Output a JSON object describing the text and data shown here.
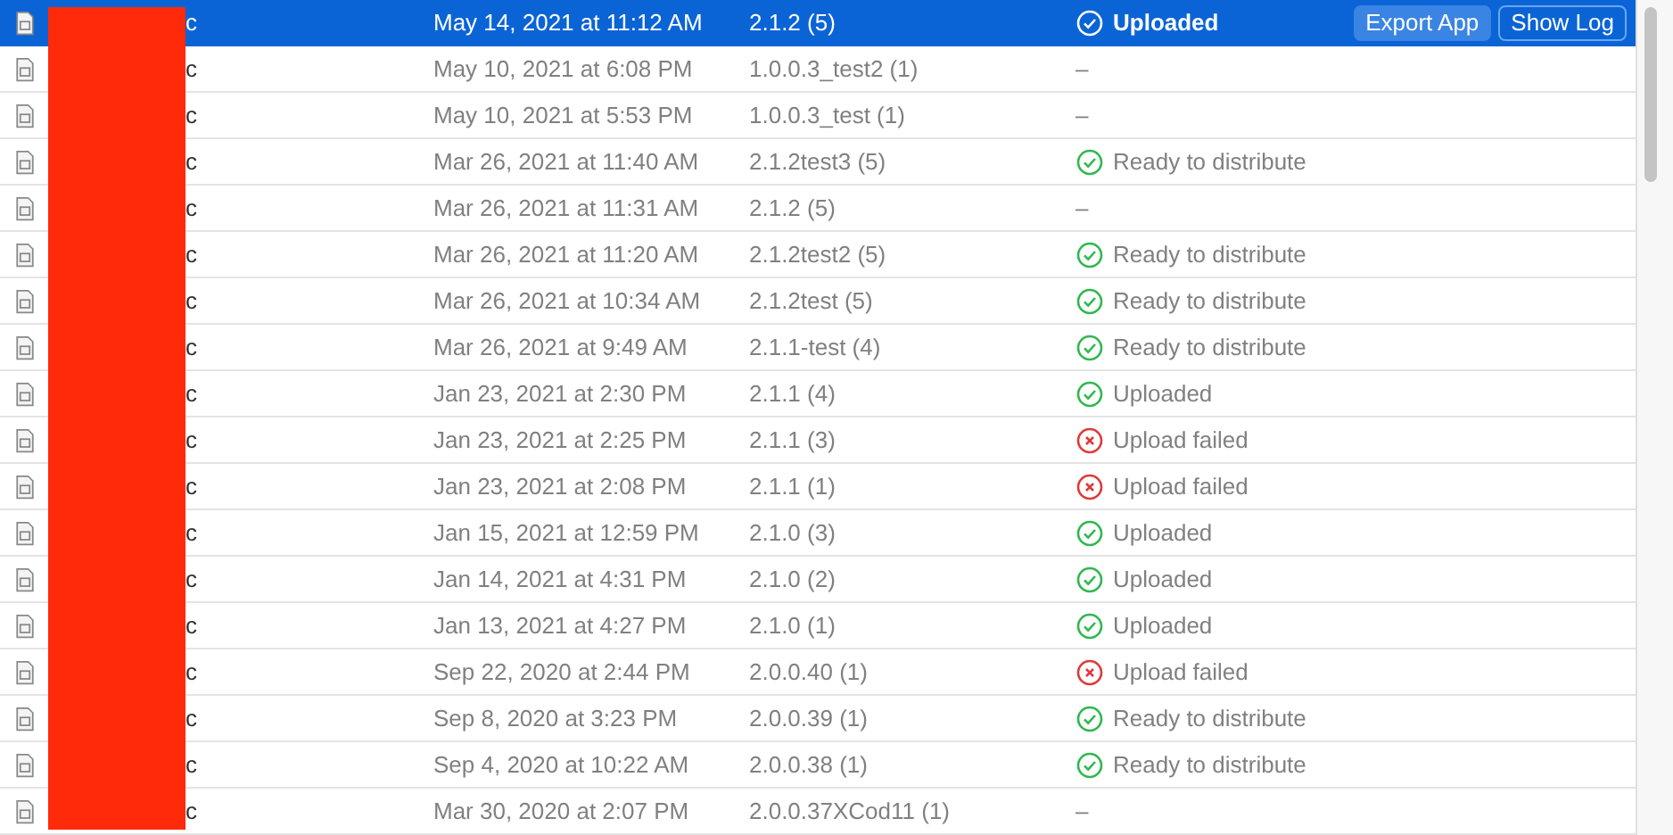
{
  "archives": [
    {
      "name": "c",
      "date": "May 14, 2021 at 11:12 AM",
      "version": "2.1.2 (5)",
      "status": {
        "kind": "success",
        "label": "Uploaded"
      },
      "selected": true,
      "actions": [
        "Export App",
        "Show Log"
      ]
    },
    {
      "name": "c",
      "date": "May 10, 2021 at 6:08 PM",
      "version": "1.0.0.3_test2 (1)",
      "status": {
        "kind": "none",
        "label": "–"
      },
      "selected": false
    },
    {
      "name": "c",
      "date": "May 10, 2021 at 5:53 PM",
      "version": "1.0.0.3_test (1)",
      "status": {
        "kind": "none",
        "label": "–"
      },
      "selected": false
    },
    {
      "name": "c",
      "date": "Mar 26, 2021 at 11:40 AM",
      "version": "2.1.2test3 (5)",
      "status": {
        "kind": "success",
        "label": "Ready to distribute"
      },
      "selected": false
    },
    {
      "name": "c",
      "date": "Mar 26, 2021 at 11:31 AM",
      "version": "2.1.2 (5)",
      "status": {
        "kind": "none",
        "label": "–"
      },
      "selected": false
    },
    {
      "name": "c",
      "date": "Mar 26, 2021 at 11:20 AM",
      "version": "2.1.2test2 (5)",
      "status": {
        "kind": "success",
        "label": "Ready to distribute"
      },
      "selected": false
    },
    {
      "name": "c",
      "date": "Mar 26, 2021 at 10:34 AM",
      "version": "2.1.2test (5)",
      "status": {
        "kind": "success",
        "label": "Ready to distribute"
      },
      "selected": false
    },
    {
      "name": "c",
      "date": "Mar 26, 2021 at 9:49 AM",
      "version": "2.1.1-test (4)",
      "status": {
        "kind": "success",
        "label": "Ready to distribute"
      },
      "selected": false
    },
    {
      "name": "c",
      "date": "Jan 23, 2021 at 2:30 PM",
      "version": "2.1.1 (4)",
      "status": {
        "kind": "success",
        "label": "Uploaded"
      },
      "selected": false
    },
    {
      "name": "c",
      "date": "Jan 23, 2021 at 2:25 PM",
      "version": "2.1.1 (3)",
      "status": {
        "kind": "failed",
        "label": "Upload failed"
      },
      "selected": false
    },
    {
      "name": "c",
      "date": "Jan 23, 2021 at 2:08 PM",
      "version": "2.1.1 (1)",
      "status": {
        "kind": "failed",
        "label": "Upload failed"
      },
      "selected": false
    },
    {
      "name": "c",
      "date": "Jan 15, 2021 at 12:59 PM",
      "version": "2.1.0 (3)",
      "status": {
        "kind": "success",
        "label": "Uploaded"
      },
      "selected": false
    },
    {
      "name": "c",
      "date": "Jan 14, 2021 at 4:31 PM",
      "version": "2.1.0 (2)",
      "status": {
        "kind": "success",
        "label": "Uploaded"
      },
      "selected": false
    },
    {
      "name": "c",
      "date": "Jan 13, 2021 at 4:27 PM",
      "version": "2.1.0 (1)",
      "status": {
        "kind": "success",
        "label": "Uploaded"
      },
      "selected": false
    },
    {
      "name": "c",
      "date": "Sep 22, 2020 at 2:44 PM",
      "version": "2.0.0.40 (1)",
      "status": {
        "kind": "failed",
        "label": "Upload failed"
      },
      "selected": false
    },
    {
      "name": "c",
      "date": "Sep 8, 2020 at 3:23 PM",
      "version": "2.0.0.39 (1)",
      "status": {
        "kind": "success",
        "label": "Ready to distribute"
      },
      "selected": false
    },
    {
      "name": "c",
      "date": "Sep 4, 2020 at 10:22 AM",
      "version": "2.0.0.38 (1)",
      "status": {
        "kind": "success",
        "label": "Ready to distribute"
      },
      "selected": false
    },
    {
      "name": "c",
      "date": "Mar 30, 2020 at 2:07 PM",
      "version": "2.0.0.37XCod11 (1)",
      "status": {
        "kind": "none",
        "label": "–"
      },
      "selected": false
    }
  ]
}
